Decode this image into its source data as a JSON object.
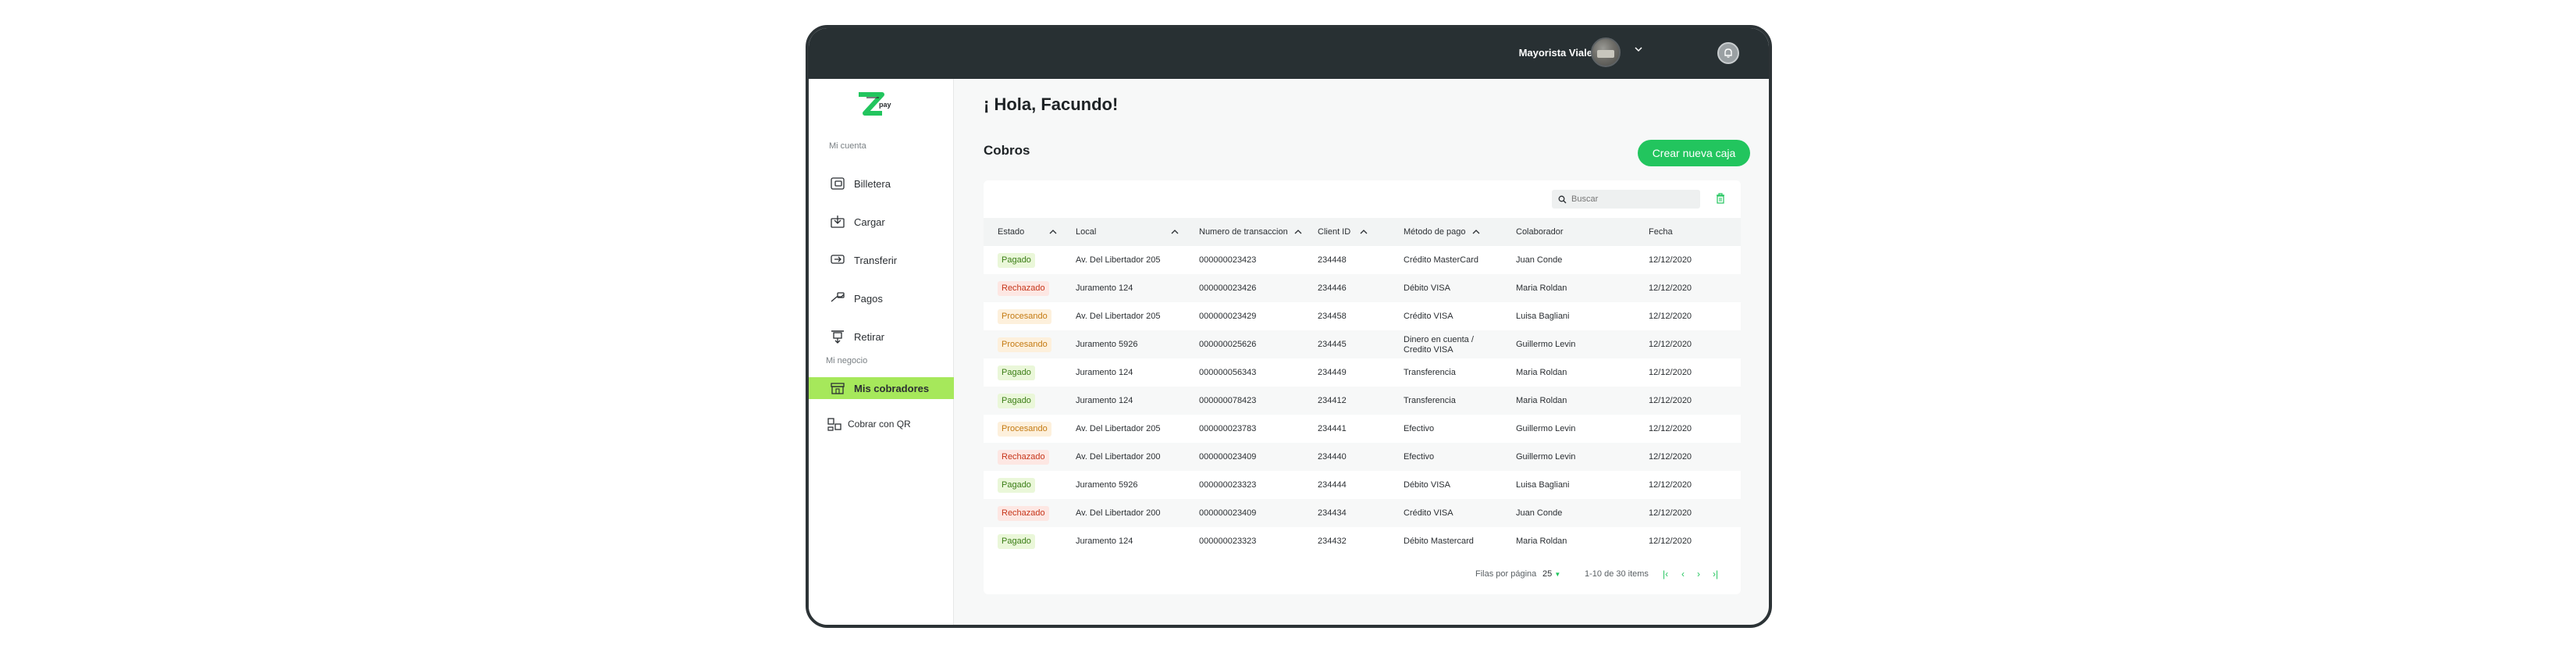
{
  "header": {
    "user_name": "Mayorista Viale"
  },
  "brand": {
    "logo_text": "pay",
    "accent": "#22c55e",
    "active_nav": "#a6e85b",
    "topbar": "#283033"
  },
  "sidebar": {
    "section_account": "Mi cuenta",
    "section_business": "Mi negocio",
    "items": [
      {
        "label": "Billetera",
        "icon": "wallet-icon"
      },
      {
        "label": "Cargar",
        "icon": "load-icon"
      },
      {
        "label": "Transferir",
        "icon": "transfer-icon"
      },
      {
        "label": "Pagos",
        "icon": "payments-icon"
      },
      {
        "label": "Retirar",
        "icon": "withdraw-icon"
      },
      {
        "label": "Mis cobradores",
        "icon": "store-icon",
        "active": true
      },
      {
        "label": "Cobrar con QR",
        "icon": "qr-icon"
      }
    ]
  },
  "main": {
    "greeting": "¡ Hola, Facundo!",
    "section_title": "Cobros",
    "create_button": "Crear nueva caja",
    "search_placeholder": "Buscar"
  },
  "table": {
    "columns": [
      "Estado",
      "Local",
      "Numero de transaccion",
      "Client ID",
      "Método de pago",
      "Colaborador",
      "Fecha"
    ],
    "rows": [
      {
        "estado": "Pagado",
        "local": "Av. Del Libertador 205",
        "tx": "000000023423",
        "client": "234448",
        "metodo": "Crédito MasterCard",
        "colaborador": "Juan Conde",
        "fecha": "12/12/2020"
      },
      {
        "estado": "Rechazado",
        "local": "Juramento 124",
        "tx": "000000023426",
        "client": "234446",
        "metodo": "Débito VISA",
        "colaborador": "Maria Roldan",
        "fecha": "12/12/2020"
      },
      {
        "estado": "Procesando",
        "local": "Av. Del Libertador 205",
        "tx": "000000023429",
        "client": "234458",
        "metodo": "Crédito VISA",
        "colaborador": "Luisa Bagliani",
        "fecha": "12/12/2020"
      },
      {
        "estado": "Procesando",
        "local": "Juramento 5926",
        "tx": "000000025626",
        "client": "234445",
        "metodo": "Dinero en cuenta / Credito VISA",
        "colaborador": "Guillermo Levin",
        "fecha": "12/12/2020"
      },
      {
        "estado": "Pagado",
        "local": "Juramento 124",
        "tx": "000000056343",
        "client": "234449",
        "metodo": "Transferencia",
        "colaborador": "Maria Roldan",
        "fecha": "12/12/2020"
      },
      {
        "estado": "Pagado",
        "local": "Juramento 124",
        "tx": "000000078423",
        "client": "234412",
        "metodo": "Transferencia",
        "colaborador": "Maria Roldan",
        "fecha": "12/12/2020"
      },
      {
        "estado": "Procesando",
        "local": "Av. Del Libertador 205",
        "tx": "000000023783",
        "client": "234441",
        "metodo": "Efectivo",
        "colaborador": "Guillermo Levin",
        "fecha": "12/12/2020"
      },
      {
        "estado": "Rechazado",
        "local": "Av. Del Libertador 200",
        "tx": "000000023409",
        "client": "234440",
        "metodo": "Efectivo",
        "colaborador": "Guillermo Levin",
        "fecha": "12/12/2020"
      },
      {
        "estado": "Pagado",
        "local": "Juramento 5926",
        "tx": "000000023323",
        "client": "234444",
        "metodo": "Débito VISA",
        "colaborador": "Luisa Bagliani",
        "fecha": "12/12/2020"
      },
      {
        "estado": "Rechazado",
        "local": "Av. Del Libertador 200",
        "tx": "000000023409",
        "client": "234434",
        "metodo": "Crédito VISA",
        "colaborador": "Juan Conde",
        "fecha": "12/12/2020"
      },
      {
        "estado": "Pagado",
        "local": "Juramento 124",
        "tx": "000000023323",
        "client": "234432",
        "metodo": "Débito Mastercard",
        "colaborador": "Maria Roldan",
        "fecha": "12/12/2020"
      }
    ]
  },
  "pagination": {
    "rows_label": "Filas por página",
    "rows_value": "25",
    "range": "1-10 de 30 items"
  }
}
